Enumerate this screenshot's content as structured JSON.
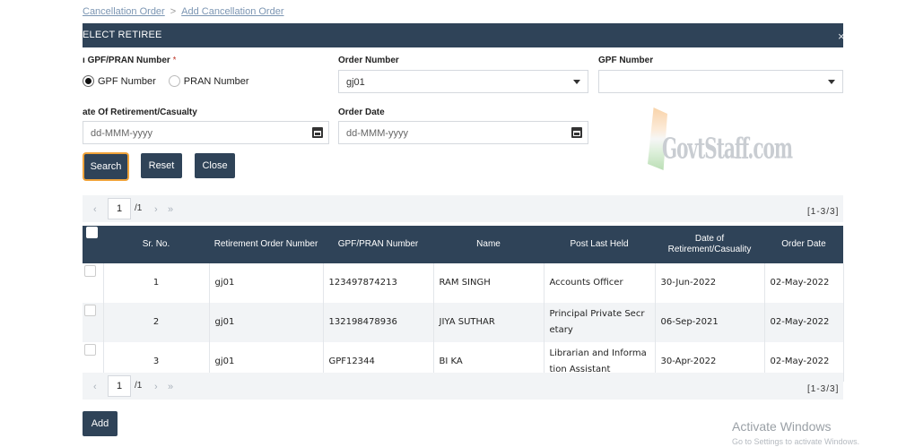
{
  "breadcrumb": {
    "parent": "Cancellation Order",
    "separator": ">",
    "current": "Add Cancellation Order"
  },
  "panel": {
    "title": "ELECT RETIREE",
    "close": "×"
  },
  "form": {
    "gpf_pran_label": "GPF/PRAN Number",
    "required_mark": "*",
    "radio_gpf": "GPF Number",
    "radio_pran": "PRAN Number",
    "selected_radio": "GPF Number",
    "order_number_label": "Order Number",
    "order_number_value": "gj01",
    "gpf_number_label": "GPF Number",
    "gpf_number_value": "",
    "retirement_date_label": "ate Of Retirement/Casualty",
    "retirement_date_placeholder": "dd-MMM-yyyy",
    "order_date_label": "Order Date",
    "order_date_placeholder": "dd-MMM-yyyy"
  },
  "buttons": {
    "search": "Search",
    "reset": "Reset",
    "close": "Close",
    "add": "Add"
  },
  "pager": {
    "first": "‹",
    "page": "1",
    "total": "/1",
    "next": "›",
    "last": "»",
    "range": "[1-3/3]"
  },
  "table": {
    "headers": [
      "Sr. No.",
      "Retirement Order Number",
      "GPF/PRAN Number",
      "Name",
      "Post Last Held",
      "Date of Retirement/Casuality",
      "Order Date"
    ],
    "rows": [
      {
        "sr": "1",
        "order": "gj01",
        "gpf": "123497874213",
        "name": "RAM SINGH",
        "post": "Accounts Officer",
        "retire": "30-Jun-2022",
        "odate": "02-May-2022"
      },
      {
        "sr": "2",
        "order": "gj01",
        "gpf": "132198478936",
        "name": "JIYA SUTHAR",
        "post": "Principal Private Secretary",
        "retire": "06-Sep-2021",
        "odate": "02-May-2022"
      },
      {
        "sr": "3",
        "order": "gj01",
        "gpf": "GPF12344",
        "name": "BI KA",
        "post": "Librarian and Information Assistant",
        "retire": "30-Apr-2022",
        "odate": "02-May-2022"
      }
    ]
  },
  "watermark": "GovtStaff.com",
  "os_notice": {
    "title": "Activate Windows",
    "subtitle": "Go to Settings to activate Windows."
  },
  "colors": {
    "header": "#2f4358",
    "focus": "#f0a33a",
    "row_alt": "#f2f4f6"
  }
}
